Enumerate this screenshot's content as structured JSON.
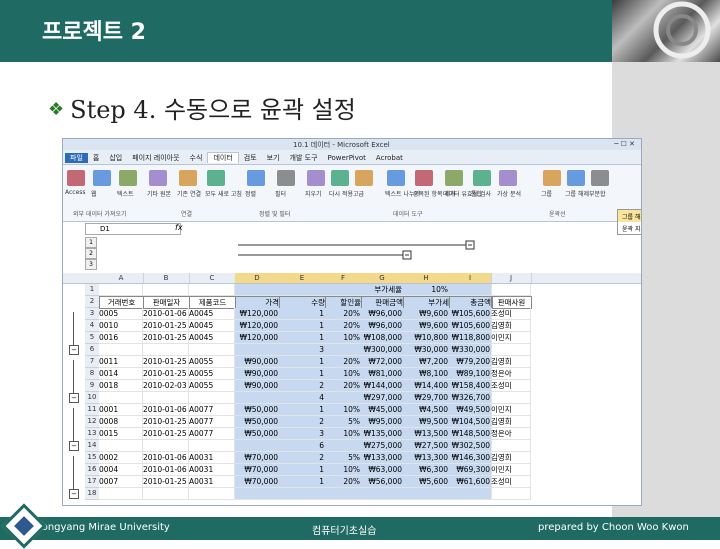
{
  "slide": {
    "title": "프로젝트 2",
    "step": "Step 4. 수동으로 윤곽 설정"
  },
  "excel": {
    "window_title": "10.1 데이터 - Microsoft Excel",
    "tabs": [
      "파일",
      "홈",
      "삽입",
      "페이지 레이아웃",
      "수식",
      "데이터",
      "검토",
      "보기",
      "개발 도구",
      "PowerPivot",
      "Acrobat"
    ],
    "active_tab": "데이터",
    "ribbon_groups": [
      "외부 데이터 가져오기",
      "연결",
      "정렬 및 필터",
      "데이터 도구",
      "윤곽선"
    ],
    "ribbon_buttons": [
      "Access",
      "웹",
      "텍스트",
      "기타 원본",
      "기존 연결",
      "모두 새로 고침",
      "정렬",
      "필터",
      "지우기",
      "다시 적용",
      "고급",
      "텍스트 나누기",
      "중복된 항목 제거",
      "데이터 유효성 검사",
      "통합",
      "가상 분석",
      "그룹",
      "그룹 해제",
      "부분합"
    ],
    "menu_items": [
      "그룹 해제(U)...",
      "윤곽 지우기(C)"
    ],
    "name_box": "D1",
    "fx": "fx",
    "outline_levels": [
      "1",
      "2",
      "3"
    ],
    "columns": [
      "A",
      "B",
      "C",
      "D",
      "E",
      "F",
      "G",
      "H",
      "I",
      "J"
    ],
    "rows": [
      {
        "n": "1",
        "cells": [
          "",
          "",
          "",
          "",
          "",
          "",
          "부가세율",
          "10%",
          "",
          ""
        ]
      },
      {
        "n": "2",
        "cells": [
          "거래번호",
          "판매일자",
          "제품코드",
          "가격",
          "수량",
          "할인율",
          "판매금액",
          "부가세",
          "총금액",
          "판매사원"
        ]
      },
      {
        "n": "3",
        "cells": [
          "0005",
          "2010-01-06",
          "A0045",
          "₩120,000",
          "1",
          "20%",
          "₩96,000",
          "₩9,600",
          "₩105,600",
          "조성미"
        ]
      },
      {
        "n": "4",
        "cells": [
          "0010",
          "2010-01-25",
          "A0045",
          "₩120,000",
          "1",
          "20%",
          "₩96,000",
          "₩9,600",
          "₩105,600",
          "김영희"
        ]
      },
      {
        "n": "5",
        "cells": [
          "0016",
          "2010-01-25",
          "A0045",
          "₩120,000",
          "1",
          "10%",
          "₩108,000",
          "₩10,800",
          "₩118,800",
          "이민지"
        ]
      },
      {
        "n": "6",
        "cells": [
          "",
          "",
          "",
          "",
          "3",
          "",
          "₩300,000",
          "₩30,000",
          "₩330,000",
          ""
        ]
      },
      {
        "n": "7",
        "cells": [
          "0011",
          "2010-01-25",
          "A0055",
          "₩90,000",
          "1",
          "20%",
          "₩72,000",
          "₩7,200",
          "₩79,200",
          "김영희"
        ]
      },
      {
        "n": "8",
        "cells": [
          "0014",
          "2010-01-25",
          "A0055",
          "₩90,000",
          "1",
          "10%",
          "₩81,000",
          "₩8,100",
          "₩89,100",
          "정은아"
        ]
      },
      {
        "n": "9",
        "cells": [
          "0018",
          "2010-02-03",
          "A0055",
          "₩90,000",
          "2",
          "20%",
          "₩144,000",
          "₩14,400",
          "₩158,400",
          "조성미"
        ]
      },
      {
        "n": "10",
        "cells": [
          "",
          "",
          "",
          "",
          "4",
          "",
          "₩297,000",
          "₩29,700",
          "₩326,700",
          ""
        ]
      },
      {
        "n": "11",
        "cells": [
          "0001",
          "2010-01-06",
          "A0077",
          "₩50,000",
          "1",
          "10%",
          "₩45,000",
          "₩4,500",
          "₩49,500",
          "이민지"
        ]
      },
      {
        "n": "12",
        "cells": [
          "0008",
          "2010-01-25",
          "A0077",
          "₩50,000",
          "2",
          "5%",
          "₩95,000",
          "₩9,500",
          "₩104,500",
          "김영희"
        ]
      },
      {
        "n": "13",
        "cells": [
          "0015",
          "2010-01-25",
          "A0077",
          "₩50,000",
          "3",
          "10%",
          "₩135,000",
          "₩13,500",
          "₩148,500",
          "정은아"
        ]
      },
      {
        "n": "14",
        "cells": [
          "",
          "",
          "",
          "",
          "6",
          "",
          "₩275,000",
          "₩27,500",
          "₩302,500",
          ""
        ]
      },
      {
        "n": "15",
        "cells": [
          "0002",
          "2010-01-06",
          "A0031",
          "₩70,000",
          "2",
          "5%",
          "₩133,000",
          "₩13,300",
          "₩146,300",
          "김영희"
        ]
      },
      {
        "n": "16",
        "cells": [
          "0004",
          "2010-01-06",
          "A0031",
          "₩70,000",
          "1",
          "10%",
          "₩63,000",
          "₩6,300",
          "₩69,300",
          "이민지"
        ]
      },
      {
        "n": "17",
        "cells": [
          "0007",
          "2010-01-25",
          "A0031",
          "₩70,000",
          "1",
          "20%",
          "₩56,000",
          "₩5,600",
          "₩61,600",
          "조성미"
        ]
      },
      {
        "n": "18",
        "cells": [
          "",
          "",
          "",
          "",
          "",
          "",
          "",
          "",
          "",
          ""
        ]
      }
    ]
  },
  "footer": {
    "left": "Dongyang Mirae University",
    "center": "컴퓨터기초실습",
    "right": "prepared by Choon Woo Kwon"
  },
  "colors": {
    "header": "#1f6a63",
    "selection": "#c6d9f1",
    "highlight": "#f5d98a"
  }
}
